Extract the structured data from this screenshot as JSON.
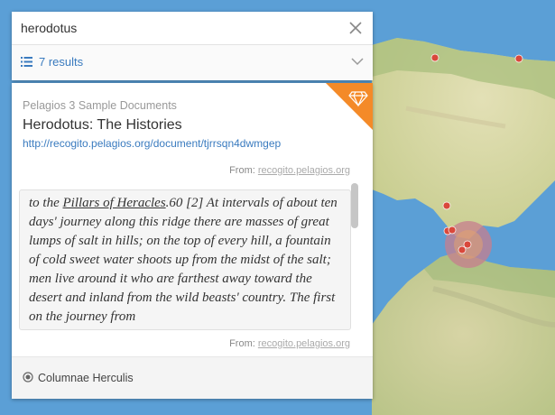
{
  "search": {
    "value": "herodotus",
    "placeholder": ""
  },
  "results": {
    "count_label": "7 results"
  },
  "card": {
    "source": "Pelagios 3 Sample Documents",
    "title": "Herodotus: The Histories",
    "url": "http://recogito.pelagios.org/document/tjrrsqn4dwmgep",
    "from_prefix": "From:",
    "from_link": "recogito.pelagios.org",
    "snippet": {
      "before": "to the ",
      "highlight": "Pillars of Heracles",
      "after": ".60 [2] At intervals of about ten days' journey along this ridge there are masses of great lumps of salt in hills; on the top of every hill, a fountain of cold sweet water shoots up from the midst of the salt; men live around it who are farthest away toward the desert and inland from the wild beasts' country. The first on the journey from"
    },
    "from2_prefix": "From:",
    "from2_link": "recogito.pelagios.org",
    "place": "Columnae Herculis"
  },
  "colors": {
    "accent": "#3a7bbf",
    "corner": "#f48a28",
    "sea": "#5b9fd6",
    "marker": "#d9483b",
    "highlight_zone": "#c98a8f"
  },
  "icons": {
    "clear": "close-icon",
    "results": "list-icon",
    "expand": "chevron-down-icon",
    "corner": "gem-icon",
    "place": "map-pin-icon"
  }
}
